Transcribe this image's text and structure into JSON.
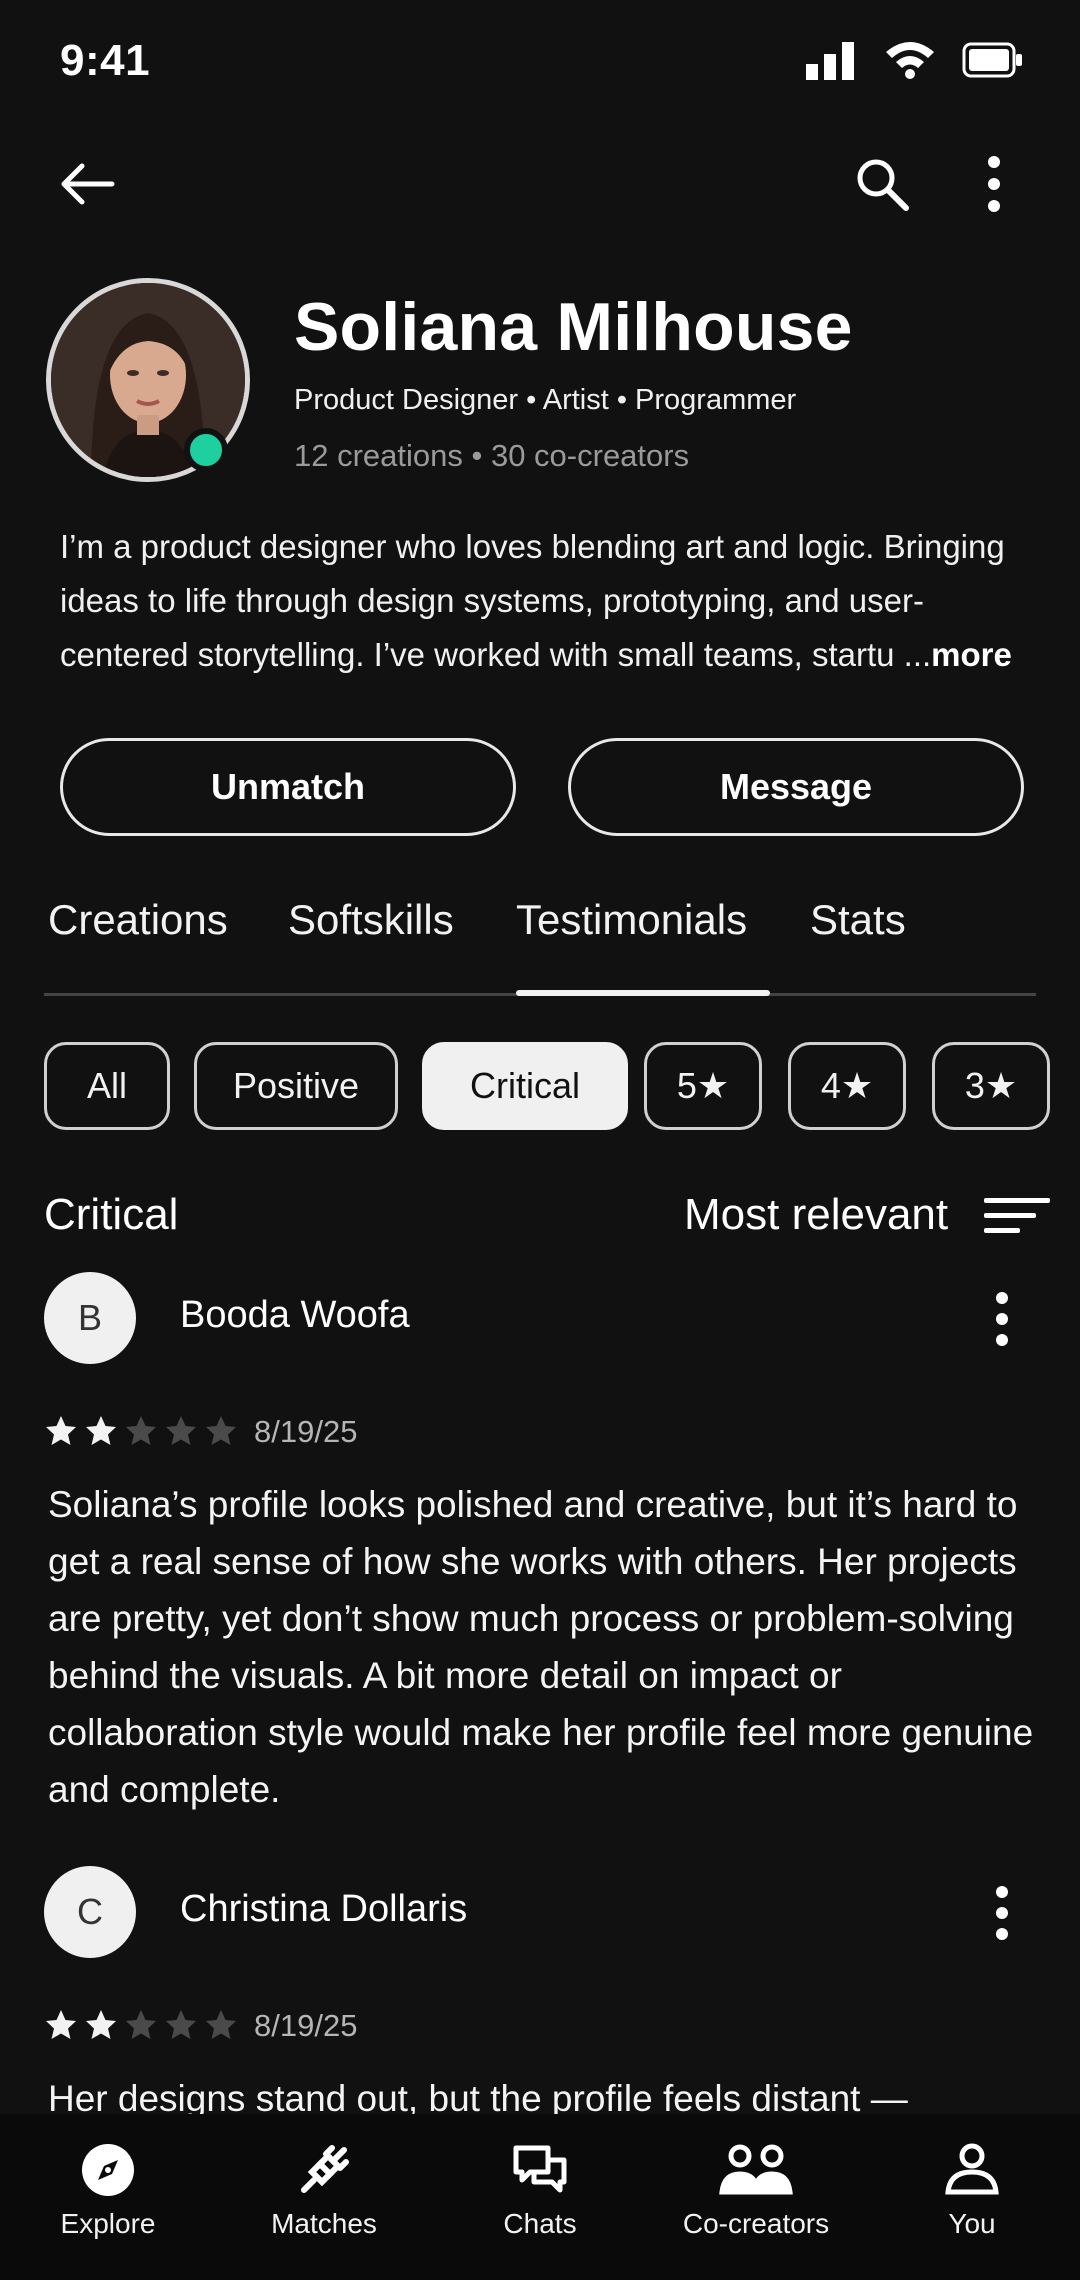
{
  "status_bar": {
    "time": "9:41",
    "icons": [
      "signal-icon",
      "wifi-icon",
      "battery-icon"
    ]
  },
  "app_bar": {
    "icons": [
      "back-arrow-icon",
      "search-icon",
      "more-vertical-icon"
    ]
  },
  "profile": {
    "name": "Soliana Milhouse",
    "roles": "Product Designer • Artist • Programmer",
    "stats": "12 creations • 30 co-creators",
    "online_color": "#1ed0a0",
    "bio": "I’m a product designer who loves blending art and logic. Bringing ideas to life through design systems, prototyping, and user-centered storytelling. I’ve worked with small teams, startu ...",
    "bio_more": "more"
  },
  "actions": {
    "unmatch": "Unmatch",
    "message": "Message"
  },
  "tabs": [
    "Creations",
    "Softskills",
    "Testimonials",
    "Stats"
  ],
  "active_tab": "Testimonials",
  "filters": [
    "All",
    "Positive",
    "Critical",
    "5★",
    "4★",
    "3★"
  ],
  "active_filter": "Critical",
  "list": {
    "title": "Critical",
    "sort_label": "Most relevant"
  },
  "reviews": [
    {
      "initial": "B",
      "author": "Booda Woofa",
      "rating": 2,
      "rating_max": 5,
      "date": "8/19/25",
      "text": "Soliana’s profile looks polished and creative, but it’s hard to get a real sense of how she works with others. Her projects are pretty, yet don’t show much process or problem-solving behind the visuals. A bit more detail on impact or collaboration style would make her profile feel more genuine and complete."
    },
    {
      "initial": "C",
      "author": "Christina Dollaris",
      "rating": 2,
      "rating_max": 5,
      "date": "8/19/25",
      "text": "Her designs stand out, but the profile feels distant —"
    }
  ],
  "bottom_nav": [
    {
      "label": "Explore",
      "icon": "compass-icon"
    },
    {
      "label": "Matches",
      "icon": "plug-icon"
    },
    {
      "label": "Chats",
      "icon": "chat-bubbles-icon"
    },
    {
      "label": "Co-creators",
      "icon": "people-icon"
    },
    {
      "label": "You",
      "icon": "person-icon"
    }
  ],
  "colors": {
    "background": "#111111",
    "text": "#f2f2f2",
    "star_filled": "#f2f2f2",
    "star_empty": "#4a4a4a"
  }
}
